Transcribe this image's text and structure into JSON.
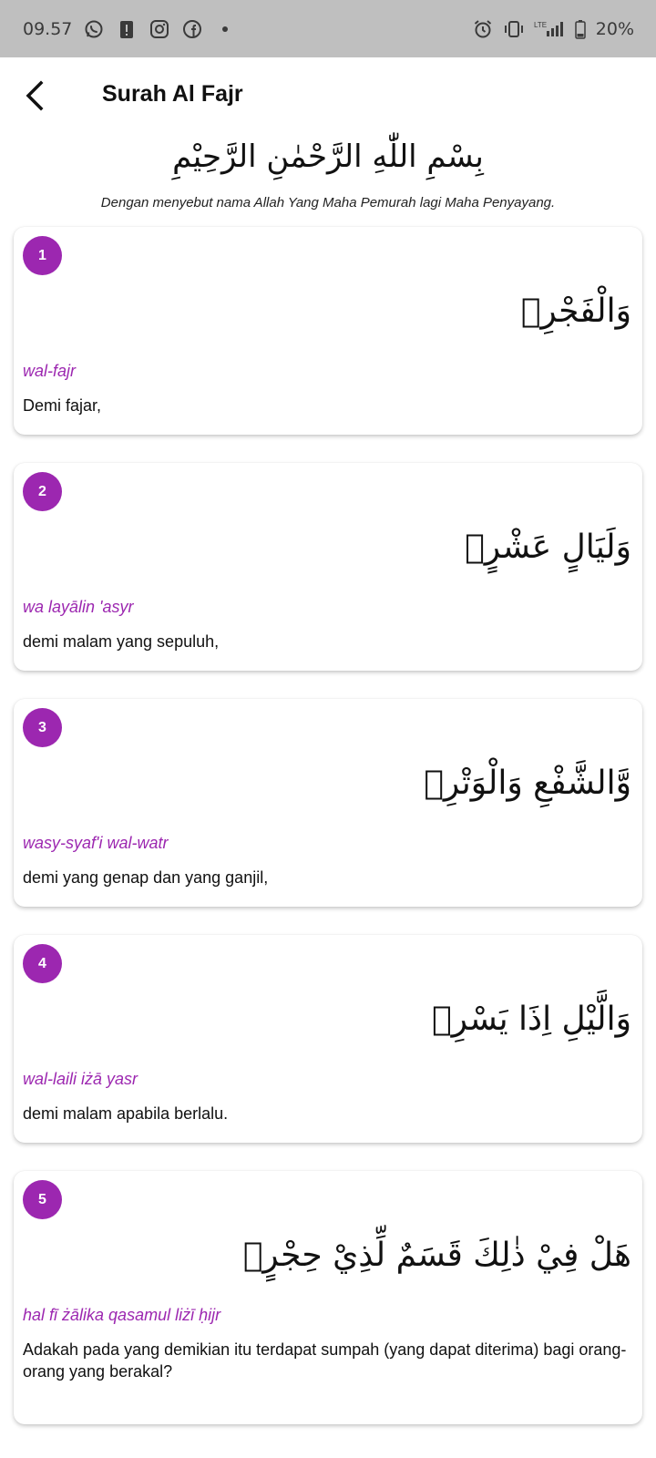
{
  "status_bar": {
    "time": "09.57",
    "battery": "20%",
    "network": "LTE",
    "left_icons": [
      "whatsapp-icon",
      "alert-icon",
      "instagram-icon",
      "facebook-icon",
      "dot-icon"
    ],
    "right_icons": [
      "alarm-icon",
      "vibrate-icon",
      "lte-signal-icon",
      "battery-icon"
    ]
  },
  "header": {
    "title": "Surah Al Fajr"
  },
  "bismillah": {
    "arabic": "بِسْمِ اللّٰهِ الرَّحْمٰنِ الرَّحِيْمِ",
    "translation": "Dengan menyebut nama Allah Yang Maha Pemurah lagi Maha Penyayang."
  },
  "ayahs": [
    {
      "number": "1",
      "arabic": "وَالْفَجْرِۙ",
      "latin": "wal-fajr",
      "translation": "Demi fajar,"
    },
    {
      "number": "2",
      "arabic": "وَلَيَالٍ عَشْرٍۙ",
      "latin": "wa layālin 'asyr",
      "translation": "demi malam yang sepuluh,"
    },
    {
      "number": "3",
      "arabic": "وَّالشَّفْعِ وَالْوَتْرِۙ",
      "latin": "wasy-syaf'i wal-watr",
      "translation": "demi yang genap dan yang ganjil,"
    },
    {
      "number": "4",
      "arabic": "وَالَّيْلِ اِذَا يَسْرِۚ",
      "latin": "wal-laili iżā yasr",
      "translation": "demi malam apabila berlalu."
    },
    {
      "number": "5",
      "arabic": "هَلْ فِيْ ذٰلِكَ قَسَمٌ لِّذِيْ حِجْرٍۗ",
      "latin": "hal fī żālika qasamul liżī ḥijr",
      "translation": "Adakah pada yang demikian itu terdapat sumpah (yang dapat diterima) bagi orang-orang yang berakal?"
    }
  ],
  "colors": {
    "accent": "#9c27b0",
    "status_bar_bg": "#bfbfbf"
  }
}
